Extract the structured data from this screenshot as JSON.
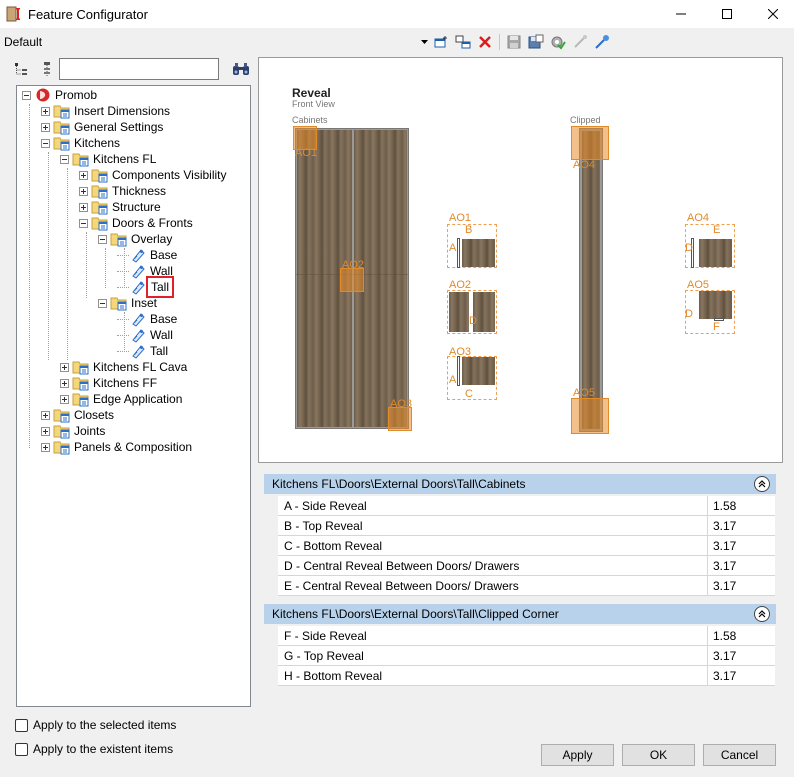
{
  "window": {
    "title": "Feature Configurator",
    "controls": [
      "minimize-icon",
      "maximize-icon",
      "close-icon"
    ]
  },
  "toolbar": {
    "profile": "Default",
    "icons": [
      "dropdown-arrow-icon",
      "new-item-icon",
      "copy-item-icon",
      "delete-icon",
      "save-icon",
      "save-as-icon",
      "validate-icon",
      "link-icon",
      "pick-icon"
    ],
    "accent_delete": "#d81e1e"
  },
  "tree_tools": {
    "icons": [
      "collapse-tree-icon",
      "filter-tree-icon",
      "binoculars-icon"
    ],
    "search_value": "",
    "search_placeholder": ""
  },
  "tree": {
    "root": "Promob",
    "items": {
      "insert_dimensions": "Insert Dimensions",
      "general_settings": "General Settings",
      "kitchens": "Kitchens",
      "kitchens_fl": "Kitchens FL",
      "components_visibility": "Components Visibility",
      "thickness": "Thickness",
      "structure": "Structure",
      "doors_fronts": "Doors & Fronts",
      "overlay": "Overlay",
      "overlay_base": "Base",
      "overlay_wall": "Wall",
      "overlay_tall": "Tall",
      "inset": "Inset",
      "inset_base": "Base",
      "inset_wall": "Wall",
      "inset_tall": "Tall",
      "kitchens_fl_cava": "Kitchens FL Cava",
      "kitchens_ff": "Kitchens FF",
      "edge_application": "Edge Application",
      "closets": "Closets",
      "joints": "Joints",
      "panels_composition": "Panels & Composition"
    },
    "selected": "overlay_tall",
    "selection_color": "#e0202a"
  },
  "preview": {
    "title": "Reveal",
    "subtitle": "Front View",
    "cabinets_label": "Cabinets",
    "clipped_label": "Clipped",
    "labels": {
      "ao1": "AO1",
      "ao2": "AO2",
      "ao3": "AO3",
      "ao4": "AO4",
      "ao5": "AO5",
      "a": "A",
      "b": "B",
      "c": "C",
      "d": "D",
      "e": "E",
      "f": "F"
    },
    "accent": "#e08a2a"
  },
  "sections": [
    {
      "title": "Kitchens FL\\Doors\\External Doors\\Tall\\Cabinets",
      "rows": [
        {
          "name": "A - Side Reveal",
          "value": "1.58"
        },
        {
          "name": "B - Top Reveal",
          "value": "3.17"
        },
        {
          "name": "C - Bottom Reveal",
          "value": "3.17"
        },
        {
          "name": "D - Central Reveal Between Doors/ Drawers",
          "value": "3.17"
        },
        {
          "name": "E - Central Reveal Between Doors/ Drawers",
          "value": "3.17"
        }
      ]
    },
    {
      "title": "Kitchens FL\\Doors\\External Doors\\Tall\\Clipped Corner",
      "rows": [
        {
          "name": "F - Side Reveal",
          "value": "1.58"
        },
        {
          "name": "G - Top Reveal",
          "value": "3.17"
        },
        {
          "name": "H - Bottom Reveal",
          "value": "3.17"
        }
      ]
    }
  ],
  "section_header_color": "#b8d2ec",
  "footer": {
    "apply_selected": "Apply to the selected items",
    "apply_existent": "Apply to the existent items",
    "apply_selected_checked": false,
    "apply_existent_checked": false,
    "apply_button": "Apply",
    "ok_button": "OK",
    "cancel_button": "Cancel"
  }
}
